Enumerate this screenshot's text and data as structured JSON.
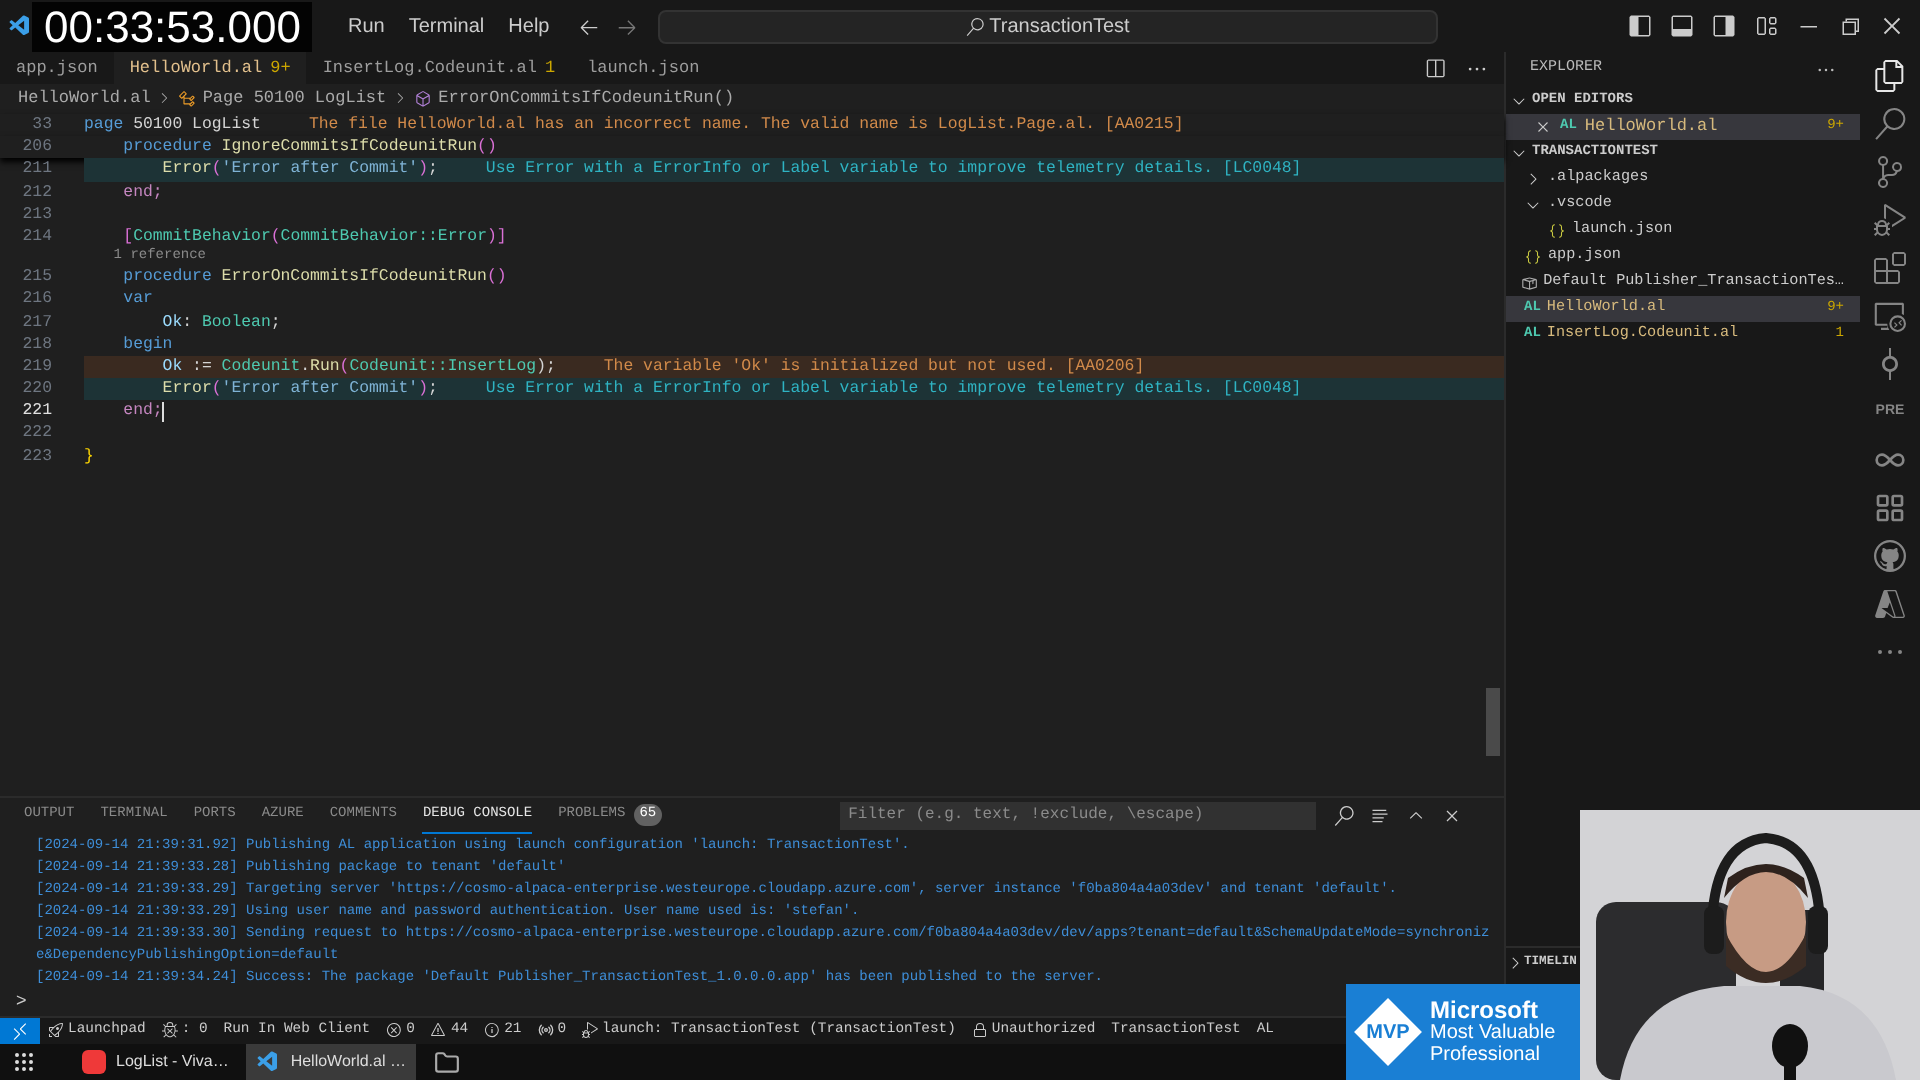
{
  "overlay": {
    "timestamp": "00:33:53.000"
  },
  "menu": [
    "Run",
    "Terminal",
    "Help"
  ],
  "command_center": {
    "label": "TransactionTest"
  },
  "tabs": [
    {
      "label": "app.json",
      "selected": false
    },
    {
      "label": "HelloWorld.al",
      "badge": "9+",
      "selected": true
    },
    {
      "label": "InsertLog.Codeunit.al",
      "badge": "1",
      "selected": false
    },
    {
      "label": "launch.json",
      "selected": false
    }
  ],
  "breadcrumb": [
    "HelloWorld.al",
    "Page 50100 LogList",
    "ErrorOnCommitsIfCodeunitRun()"
  ],
  "code": [
    {
      "number": "33",
      "sticky": true,
      "current": false,
      "tokens": [
        {
          "text": "page",
          "kind": "keyword"
        },
        {
          "text": " 50100 LogList",
          "kind": "plain"
        }
      ],
      "diagnostic": {
        "kind": "warning",
        "text": "The file HelloWorld.al has an incorrect name. The valid name is LogList.Page.al. [AA0215]"
      }
    },
    {
      "number": "206",
      "sticky": true,
      "current": false,
      "tokens": [
        {
          "text": "    procedure",
          "kind": "keyword"
        },
        {
          "text": " IgnoreCommitsIfCodeunitRun",
          "kind": "function"
        },
        {
          "text": "()",
          "kind": "bracket"
        }
      ]
    },
    {
      "number": "211",
      "sticky": false,
      "current": false,
      "tokens": [
        {
          "text": "        Error",
          "kind": "function"
        },
        {
          "text": "(",
          "kind": "bracket"
        },
        {
          "text": "'Error after Commit'",
          "kind": "string"
        },
        {
          "text": ")",
          "kind": "bracket"
        },
        {
          "text": ";",
          "kind": "plain"
        }
      ],
      "diagnostic": {
        "kind": "info",
        "text": "Use Error with a ErrorInfo or Label variable to improve telemetry details. [LC0048]"
      }
    },
    {
      "number": "212",
      "sticky": false,
      "current": false,
      "tokens": [
        {
          "text": "    end;",
          "kind": "control"
        }
      ]
    },
    {
      "number": "213",
      "sticky": false,
      "current": false
    },
    {
      "number": "214",
      "sticky": false,
      "current": false,
      "tokens": [
        {
          "text": "    [",
          "kind": "bracket"
        },
        {
          "text": "CommitBehavior",
          "kind": "type"
        },
        {
          "text": "(",
          "kind": "bracket"
        },
        {
          "text": "CommitBehavior::Error",
          "kind": "type"
        },
        {
          "text": ")]",
          "kind": "bracket"
        }
      ]
    },
    {
      "kind": "codelens",
      "text": "    1 reference"
    },
    {
      "number": "215",
      "sticky": false,
      "current": false,
      "tokens": [
        {
          "text": "    procedure",
          "kind": "keyword"
        },
        {
          "text": " ErrorOnCommitsIfCodeunitRun",
          "kind": "function"
        },
        {
          "text": "()",
          "kind": "bracket"
        }
      ]
    },
    {
      "number": "216",
      "sticky": false,
      "current": false,
      "tokens": [
        {
          "text": "    var",
          "kind": "keyword"
        }
      ]
    },
    {
      "number": "217",
      "sticky": false,
      "current": false,
      "tokens": [
        {
          "text": "        Ok",
          "kind": "variable"
        },
        {
          "text": ": ",
          "kind": "plain"
        },
        {
          "text": "Boolean",
          "kind": "type"
        },
        {
          "text": ";",
          "kind": "plain"
        }
      ]
    },
    {
      "number": "218",
      "sticky": false,
      "current": false,
      "tokens": [
        {
          "text": "    begin",
          "kind": "keyword"
        }
      ]
    },
    {
      "number": "219",
      "sticky": false,
      "current": false,
      "tokens": [
        {
          "text": "        Ok",
          "kind": "variable"
        },
        {
          "text": " := ",
          "kind": "plain"
        },
        {
          "text": "Codeunit",
          "kind": "type"
        },
        {
          "text": ".",
          "kind": "plain"
        },
        {
          "text": "Run",
          "kind": "function"
        },
        {
          "text": "(",
          "kind": "bracket"
        },
        {
          "text": "Codeunit::InsertLog",
          "kind": "type"
        },
        {
          "text": ");",
          "kind": "plain"
        }
      ],
      "diagnostic": {
        "kind": "warning",
        "text": "The variable 'Ok' is initialized but not used. [AA0206]"
      }
    },
    {
      "number": "220",
      "sticky": false,
      "current": false,
      "tokens": [
        {
          "text": "        Error",
          "kind": "function"
        },
        {
          "text": "(",
          "kind": "bracket"
        },
        {
          "text": "'Error after Commit'",
          "kind": "string"
        },
        {
          "text": ")",
          "kind": "bracket"
        },
        {
          "text": ";",
          "kind": "plain"
        }
      ],
      "diagnostic": {
        "kind": "info",
        "text": "Use Error with a ErrorInfo or Label variable to improve telemetry details. [LC0048]"
      }
    },
    {
      "number": "221",
      "sticky": false,
      "current": true,
      "tokens": [
        {
          "text": "    end;",
          "kind": "control"
        }
      ]
    },
    {
      "number": "222",
      "sticky": false,
      "current": false
    },
    {
      "number": "223",
      "sticky": false,
      "current": false,
      "tokens": [
        {
          "text": "}",
          "kind": "brace"
        }
      ]
    }
  ],
  "panel": {
    "tabs": [
      {
        "label": "OUTPUT",
        "selected": false
      },
      {
        "label": "TERMINAL",
        "selected": false
      },
      {
        "label": "PORTS",
        "selected": false
      },
      {
        "label": "AZURE",
        "selected": false
      },
      {
        "label": "COMMENTS",
        "selected": false
      },
      {
        "label": "DEBUG CONSOLE",
        "selected": true
      },
      {
        "label": "PROBLEMS",
        "selected": false,
        "badge": "65"
      }
    ],
    "filter": {
      "placeholder": "Filter (e.g. text, !exclude, \\escape)"
    },
    "lines": [
      "[2024-09-14 21:39:31.92] Publishing AL application using launch configuration 'launch: TransactionTest'.",
      "[2024-09-14 21:39:33.28] Publishing package to tenant 'default'",
      "[2024-09-14 21:39:33.29] Targeting server 'https://cosmo-alpaca-enterprise.westeurope.cloudapp.azure.com', server instance 'f0ba804a4a03dev' and tenant 'default'.",
      "[2024-09-14 21:39:33.29] Using user name and password authentication. User name used is: 'stefan'.",
      "[2024-09-14 21:39:33.30] Sending request to https://cosmo-alpaca-enterprise.westeurope.cloudapp.azure.com/f0ba804a4a03dev/dev/apps?tenant=default&SchemaUpdateMode=synchroniz",
      "e&DependencyPublishingOption=default",
      "[2024-09-14 21:39:34.24] Success: The package 'Default Publisher_TransactionTest_1.0.0.0.app' has been published to the server."
    ],
    "prompt": ">"
  },
  "explorer": {
    "title": "EXPLORER",
    "open_editors": {
      "title": "OPEN EDITORS",
      "expanded": true,
      "items": [
        {
          "name": "HelloWorld.al",
          "icon_text": "AL",
          "badge": "9+",
          "selected": true
        }
      ]
    },
    "workspace": {
      "title": "TRANSACTIONTEST",
      "expanded": true,
      "children": [
        {
          "kind": "folder",
          "name": ".alpackages",
          "expanded": false
        },
        {
          "kind": "folder",
          "name": ".vscode",
          "expanded": true,
          "children": [
            {
              "kind": "json",
              "name": "launch.json",
              "selected": false
            }
          ]
        },
        {
          "kind": "json",
          "name": "app.json",
          "selected": false
        },
        {
          "kind": "package",
          "name": "Default Publisher_TransactionTes…",
          "selected": false
        },
        {
          "kind": "al",
          "icon_text": "AL",
          "name": "HelloWorld.al",
          "badge": "9+",
          "selected": true
        },
        {
          "kind": "al",
          "icon_text": "AL",
          "name": "InsertLog.Codeunit.al",
          "badge": "1",
          "selected": false
        }
      ]
    },
    "timeline": {
      "title": "TIMELIN",
      "expanded": false
    }
  },
  "activity": [
    {
      "kind": "explorer",
      "selected": true
    },
    {
      "kind": "search",
      "selected": false
    },
    {
      "kind": "source-control",
      "selected": false
    },
    {
      "kind": "run",
      "selected": false
    },
    {
      "kind": "extensions",
      "selected": false
    },
    {
      "kind": "remote",
      "selected": false
    },
    {
      "kind": "commit",
      "selected": false
    },
    {
      "kind": "text",
      "label": "PRE",
      "selected": false
    },
    {
      "kind": "infinity",
      "selected": false
    },
    {
      "kind": "grid",
      "selected": false
    },
    {
      "kind": "github",
      "selected": false
    },
    {
      "kind": "azure",
      "selected": false
    },
    {
      "kind": "more",
      "selected": false
    }
  ],
  "status_bar": [
    {
      "kind": "remote"
    },
    {
      "kind": "launchpad",
      "label": "Launchpad"
    },
    {
      "kind": "debug",
      "label": ": 0"
    },
    {
      "kind": "plain",
      "label": "Run In Web Client"
    },
    {
      "kind": "error",
      "label": "0"
    },
    {
      "kind": "warning",
      "label": "44"
    },
    {
      "kind": "info",
      "label": "21"
    },
    {
      "kind": "ports",
      "label": "0"
    },
    {
      "kind": "launch",
      "label": "launch: TransactionTest (TransactionTest)"
    },
    {
      "kind": "lock",
      "label": "Unauthorized"
    },
    {
      "kind": "plain",
      "label": "TransactionTest"
    },
    {
      "kind": "plain",
      "label": "AL"
    }
  ],
  "taskbar": [
    {
      "kind": "browser",
      "label": "LogList - Viva…",
      "selected": false
    },
    {
      "kind": "vscode",
      "label": "HelloWorld.al …",
      "selected": true
    },
    {
      "kind": "folder",
      "selected": false
    }
  ],
  "badge": {
    "mark": "MVP",
    "lines": [
      "Microsoft",
      "Most Valuable",
      "Professional"
    ]
  },
  "webcam": {
    "kind": "picture"
  }
}
